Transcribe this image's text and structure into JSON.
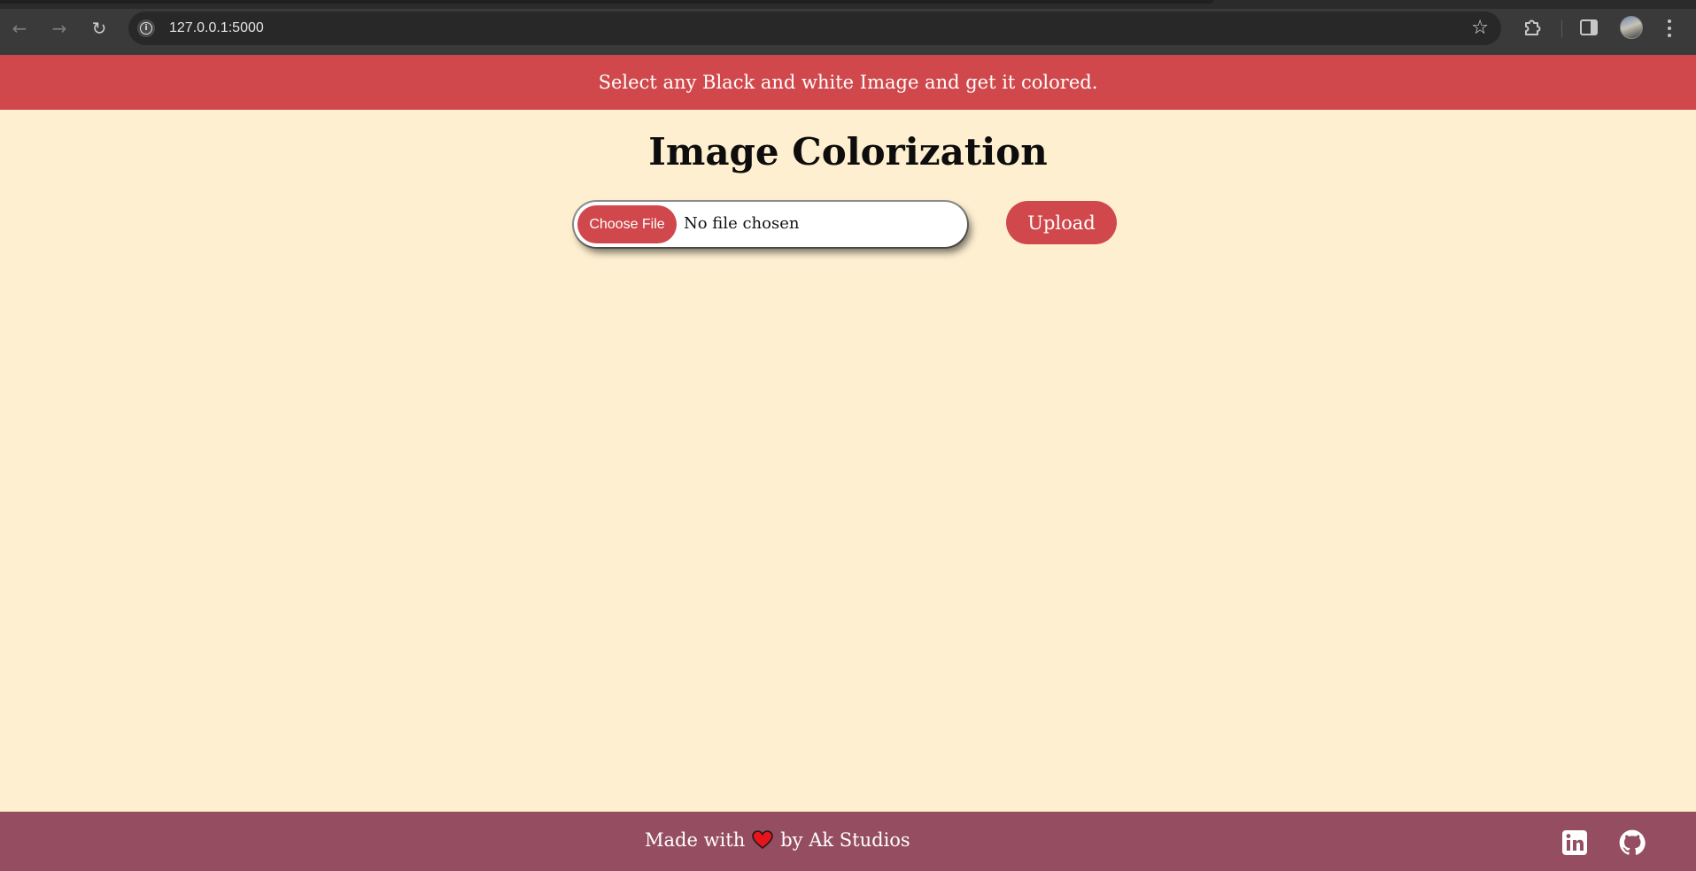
{
  "browser": {
    "url": "127.0.0.1:5000",
    "icons": {
      "back": "arrow-left-icon",
      "forward": "arrow-right-icon",
      "reload": "reload-icon",
      "site_info": "info-icon",
      "bookmark": "star-icon",
      "extensions": "puzzle-icon",
      "side_panel": "side-panel-icon",
      "menu": "kebab-menu-icon"
    }
  },
  "page": {
    "banner_text": "Select any Black and white Image and get it colored.",
    "title": "Image Colorization",
    "file_input": {
      "button_label": "Choose File",
      "status": "No file chosen"
    },
    "upload_label": "Upload",
    "footer": {
      "made_with": "Made with",
      "by": "by Ak Studios",
      "icons": [
        "heart-icon",
        "linkedin-icon",
        "github-icon"
      ]
    }
  },
  "colors": {
    "accent": "#d0484b",
    "page_background": "#fdefcf",
    "footer_background": "#954d62"
  }
}
